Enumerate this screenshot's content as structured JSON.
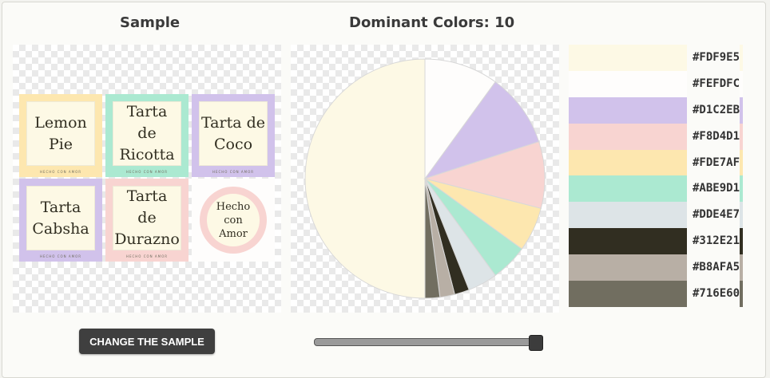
{
  "sample": {
    "title": "Sample",
    "button_label": "CHANGE THE SAMPLE"
  },
  "dominant": {
    "title_prefix": "Dominant Colors:",
    "count": "10",
    "slider_value": 10,
    "slider_max": 10
  },
  "labels": [
    {
      "text": "Lemon\nPie",
      "border": "#fde7af"
    },
    {
      "text": "Tarta\nde\nRicotta",
      "border": "#abe9d1"
    },
    {
      "text": "Tarta de\nCoco",
      "border": "#d1c2eb"
    },
    {
      "text": "Tarta\nCabsha",
      "border": "#d1c2eb"
    },
    {
      "text": "Tarta\nde\nDurazno",
      "border": "#f8d4d1"
    },
    {
      "text": "Hecho\ncon\nAmor",
      "border": "#fefdfc"
    }
  ],
  "label_footer": "HECHO CON AMOR",
  "colors": [
    {
      "hex": "#FDF9E5",
      "color": "#fdf9e5",
      "share": 0.5
    },
    {
      "hex": "#FEFDFC",
      "color": "#fefdfc",
      "share": 0.1
    },
    {
      "hex": "#D1C2EB",
      "color": "#d1c2eb",
      "share": 0.1
    },
    {
      "hex": "#F8D4D1",
      "color": "#f8d4d1",
      "share": 0.09
    },
    {
      "hex": "#FDE7AF",
      "color": "#fde7af",
      "share": 0.06
    },
    {
      "hex": "#ABE9D1",
      "color": "#abe9d1",
      "share": 0.05
    },
    {
      "hex": "#DDE4E7",
      "color": "#dde4e7",
      "share": 0.04
    },
    {
      "hex": "#312E21",
      "color": "#312e21",
      "share": 0.02
    },
    {
      "hex": "#B8AFA5",
      "color": "#b8afa5",
      "share": 0.02
    },
    {
      "hex": "#716E60",
      "color": "#716e60",
      "share": 0.02
    }
  ]
}
